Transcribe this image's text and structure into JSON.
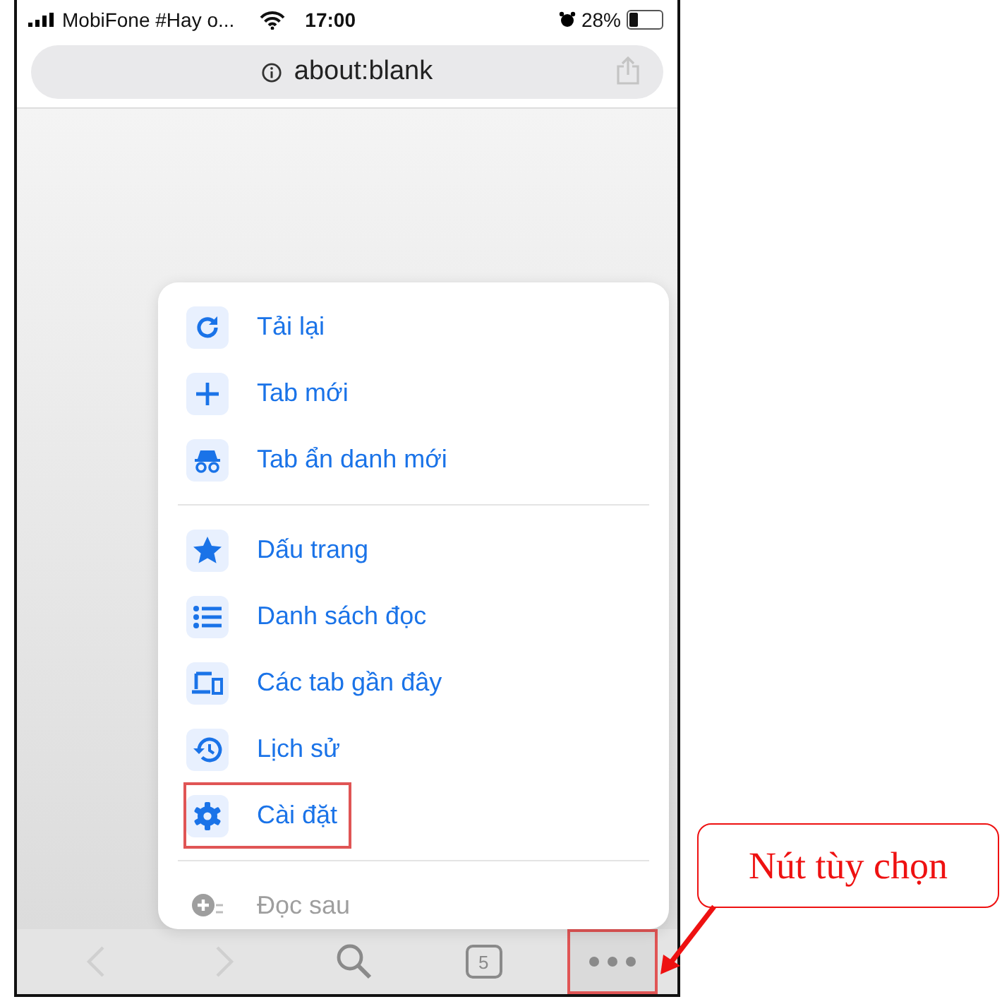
{
  "status_bar": {
    "carrier": "MobiFone #Hay o...",
    "time": "17:00",
    "battery": "28%"
  },
  "address_bar": {
    "url": "about:blank"
  },
  "menu": {
    "sections": [
      [
        {
          "label": "Tải lại",
          "disabled": false,
          "highlighted": false
        },
        {
          "label": "Tab mới",
          "disabled": false,
          "highlighted": false
        },
        {
          "label": "Tab ẩn danh mới",
          "disabled": false,
          "highlighted": false
        }
      ],
      [
        {
          "label": "Dấu trang",
          "disabled": false,
          "highlighted": false
        },
        {
          "label": "Danh sách đọc",
          "disabled": false,
          "highlighted": false
        },
        {
          "label": "Các tab gần đây",
          "disabled": false,
          "highlighted": false
        },
        {
          "label": "Lịch sử",
          "disabled": false,
          "highlighted": false
        },
        {
          "label": "Cài đặt",
          "disabled": false,
          "highlighted": true
        }
      ],
      [
        {
          "label": "Đọc sau",
          "disabled": true,
          "highlighted": false
        }
      ]
    ]
  },
  "toolbar": [
    {
      "kind": "back",
      "disabled": true,
      "highlighted": false
    },
    {
      "kind": "forward",
      "disabled": true,
      "highlighted": false
    },
    {
      "kind": "search",
      "disabled": false,
      "highlighted": false
    },
    {
      "kind": "tabs",
      "count": "5",
      "disabled": false,
      "highlighted": false
    },
    {
      "kind": "more",
      "disabled": false,
      "highlighted": true
    }
  ],
  "callout": {
    "text": "Nút tùy chọn"
  }
}
